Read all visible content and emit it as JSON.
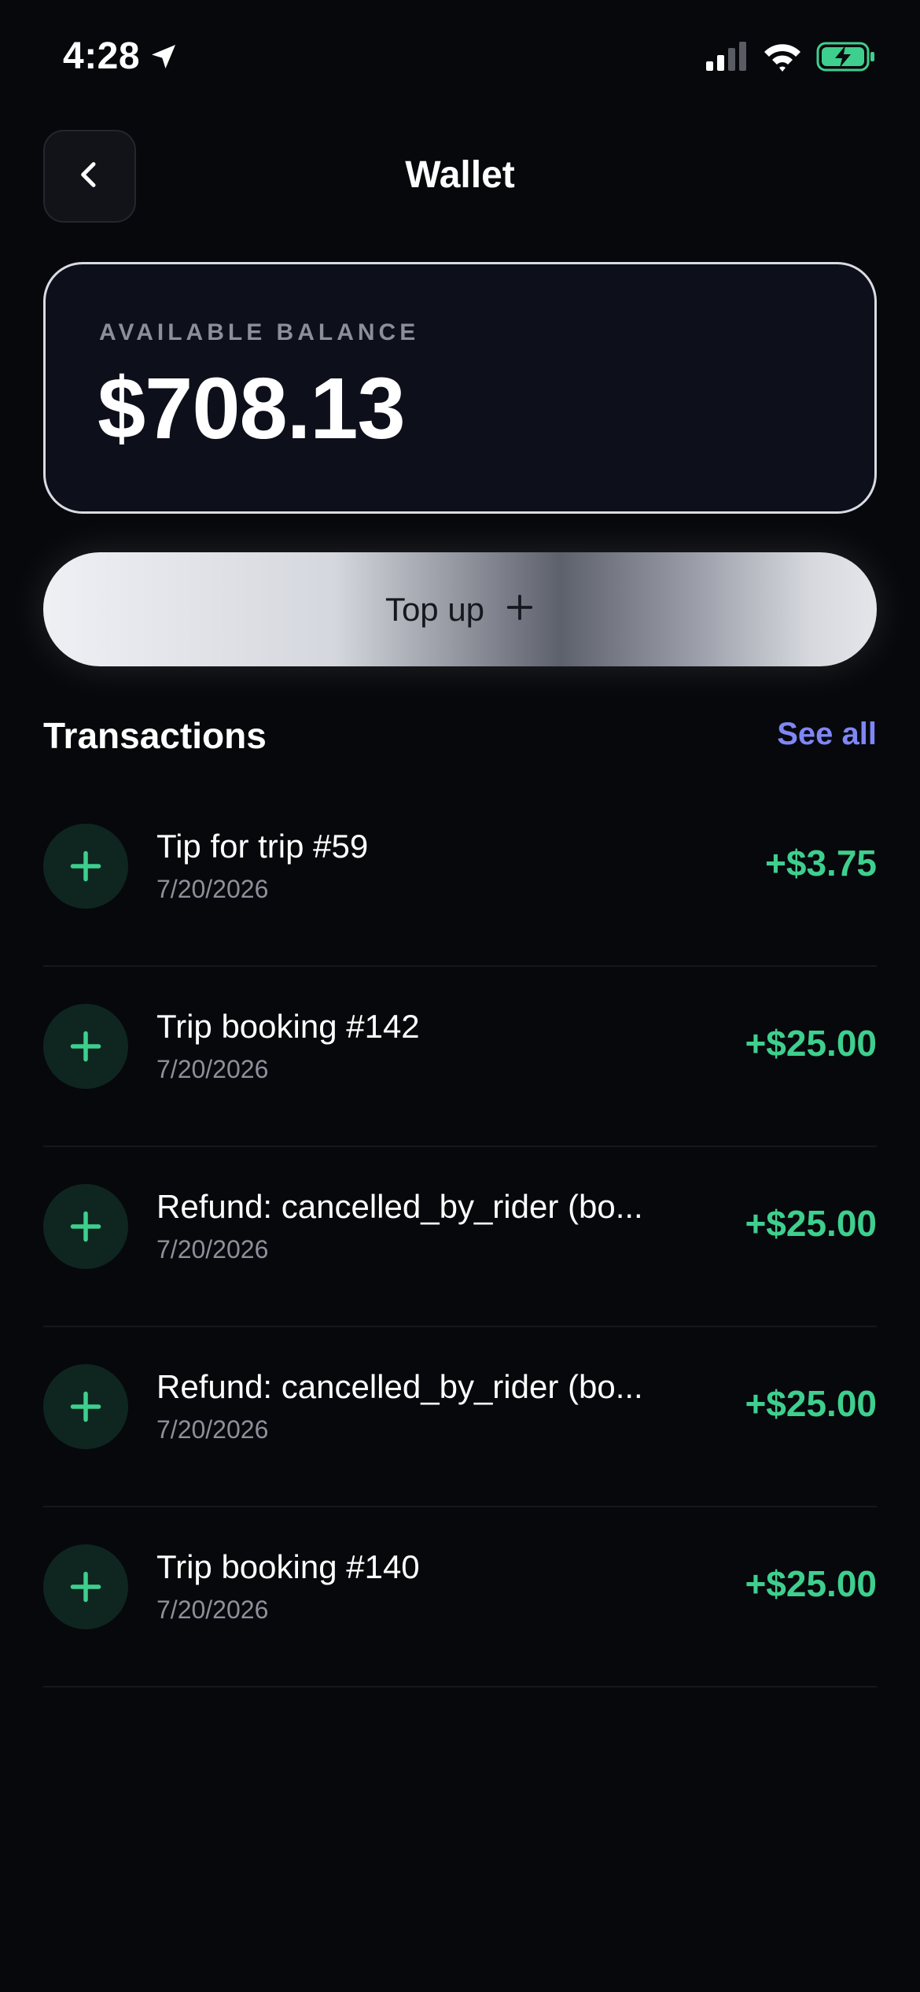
{
  "status_bar": {
    "time": "4:28",
    "battery_color": "#3ecf8e"
  },
  "header": {
    "title": "Wallet",
    "back_icon": "chevron-left-icon"
  },
  "balance": {
    "label": "AVAILABLE BALANCE",
    "amount": "$708.13"
  },
  "topup": {
    "label": "Top up",
    "icon": "plus-icon"
  },
  "transactions": {
    "title": "Transactions",
    "see_all": "See all",
    "items": [
      {
        "name": "Tip for trip #59",
        "date": "7/20/2026",
        "amount": "+$3.75",
        "icon": "plus-icon"
      },
      {
        "name": "Trip booking #142",
        "date": "7/20/2026",
        "amount": "+$25.00",
        "icon": "plus-icon"
      },
      {
        "name": "Refund: cancelled_by_rider (bo...",
        "date": "7/20/2026",
        "amount": "+$25.00",
        "icon": "plus-icon"
      },
      {
        "name": "Refund: cancelled_by_rider (bo...",
        "date": "7/20/2026",
        "amount": "+$25.00",
        "icon": "plus-icon"
      },
      {
        "name": "Trip booking #140",
        "date": "7/20/2026",
        "amount": "+$25.00",
        "icon": "plus-icon"
      }
    ]
  },
  "colors": {
    "background": "#07080c",
    "accent_green": "#3ecf8e",
    "link_purple": "#7f86f5"
  }
}
